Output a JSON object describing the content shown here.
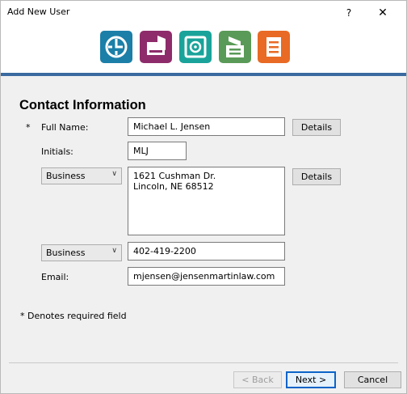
{
  "window": {
    "title": "Add New User",
    "help_label": "?",
    "close_label": "✕"
  },
  "steps": [
    {
      "icon": "clock-icon",
      "color": "#1b7fa8"
    },
    {
      "icon": "folder-icon",
      "color": "#8e2c6b"
    },
    {
      "icon": "safe-icon",
      "color": "#1aa39a"
    },
    {
      "icon": "register-icon",
      "color": "#5a9a58"
    },
    {
      "icon": "document-icon",
      "color": "#e86a24"
    }
  ],
  "section": {
    "title": "Contact Information"
  },
  "form": {
    "required_marker": "*",
    "full_name_label": "Full Name:",
    "full_name_value": "Michael L. Jensen",
    "name_details": "Details",
    "initials_label": "Initials:",
    "initials_value": "MLJ",
    "address_type": "Business",
    "address_value": "1621 Cushman Dr.\nLincoln, NE 68512",
    "address_details": "Details",
    "phone_type": "Business",
    "phone_value": "402-419-2200",
    "email_label": "Email:",
    "email_value": "mjensen@jensenmartinlaw.com",
    "required_note": "* Denotes required field"
  },
  "footer": {
    "back_label": "< Back",
    "next_label": "Next >",
    "cancel_label": "Cancel"
  }
}
